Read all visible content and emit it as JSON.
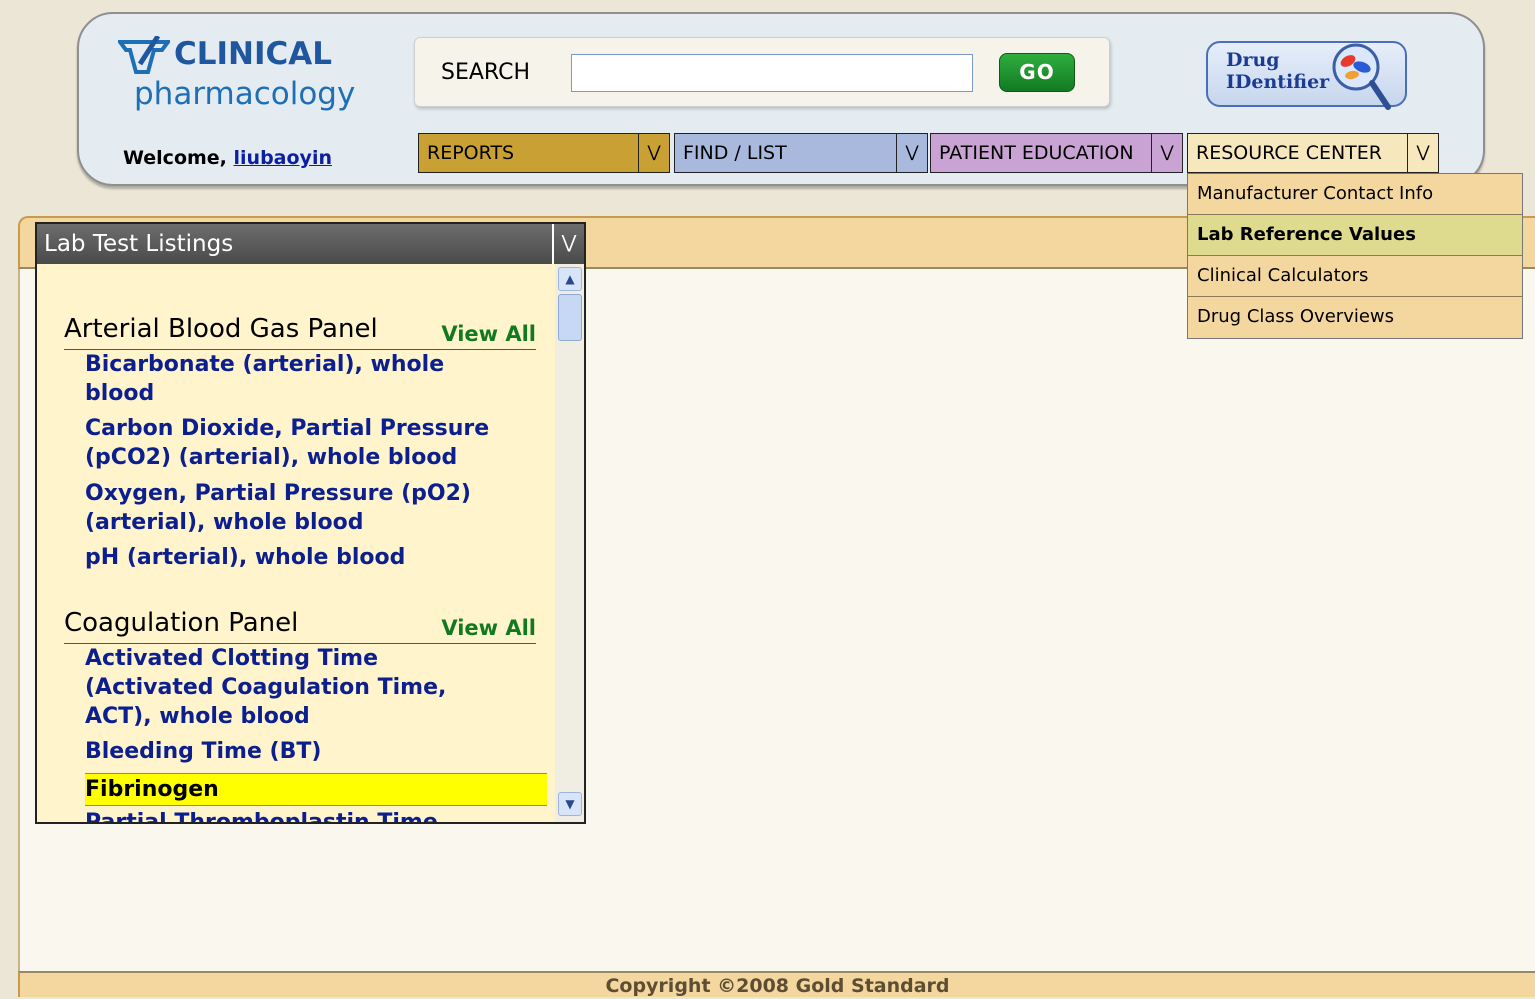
{
  "header": {
    "brand_top": "CLINICAL",
    "brand_bottom": "pharmacology",
    "welcome_prefix": "Welcome,",
    "username": "liubaoyin",
    "search_label": "SEARCH",
    "search_value": "",
    "go_label": "GO",
    "drug_identifier_line1": "Drug",
    "drug_identifier_line2": "IDentifier"
  },
  "nav": {
    "reports": "REPORTS",
    "find_list": "FIND / LIST",
    "patient_education": "PATIENT EDUCATION",
    "resource_center": "RESOURCE CENTER"
  },
  "resource_dropdown": {
    "items": [
      {
        "label": "Manufacturer Contact Info",
        "active": false
      },
      {
        "label": "Lab Reference Values",
        "active": true
      },
      {
        "label": "Clinical Calculators",
        "active": false
      },
      {
        "label": "Drug Class Overviews",
        "active": false
      }
    ]
  },
  "lab_panel": {
    "title": "Lab Test Listings",
    "view_all": "View All",
    "groups": [
      {
        "name": "Arterial Blood Gas Panel",
        "tests": [
          "Bicarbonate (arterial), whole blood",
          "Carbon Dioxide, Partial Pressure (pCO2) (arterial), whole blood",
          "Oxygen, Partial Pressure (pO2) (arterial), whole blood",
          "pH (arterial), whole blood"
        ]
      },
      {
        "name": "Coagulation Panel",
        "tests": [
          "Activated Clotting Time (Activated Coagulation Time, ACT), whole blood",
          "Bleeding Time (BT)",
          "Fibrinogen",
          "Partial Thromboplastin Time, activated"
        ]
      }
    ]
  },
  "footer": {
    "copyright": "Copyright ©2008 Gold Standard"
  },
  "colors": {
    "reports": "#c9a033",
    "find_list": "#a9b9dd",
    "patient_education": "#c9a3d3",
    "resource_center": "#f6e7bd",
    "highlight": "#ffff00",
    "link": "#0b1f8f"
  }
}
